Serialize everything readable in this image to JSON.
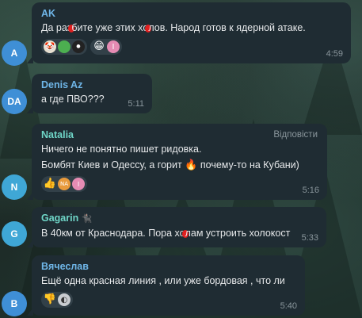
{
  "messages": [
    {
      "sender": "AK",
      "sender_color": "#6fb6e8",
      "avatar_initials": "A",
      "avatar_color": "#3f8fd6",
      "text_a": "Да раз",
      "text_b": "бите уже этих хо",
      "text_c": "лов. Народ готов к ядерной атаке.",
      "time": "4:59",
      "reactions": [
        "clown-face",
        "sticker",
        "sticker",
        "grinning-face",
        "pink-avatar"
      ]
    },
    {
      "sender": "Denis Az",
      "sender_color": "#6fb6e8",
      "avatar_initials": "DA",
      "avatar_color": "#3f8fd6",
      "text": "а где ПВО???",
      "time": "5:11"
    },
    {
      "sender": "Natalia",
      "sender_color": "#6fd6c8",
      "avatar_initials": "N",
      "avatar_color": "#3fa7d6",
      "reply_label": "Відповісти",
      "line1": "Ничего не понятно пишет ридовка.",
      "line2_a": "Бомбят Киев и Одессу, а горит",
      "line2_emoji": "🔥",
      "line2_b": "почему-то на Кубани)",
      "reaction_badges": [
        "NA",
        "I"
      ],
      "time": "5:16"
    },
    {
      "sender": "Gagarin",
      "sender_badge": "🐈‍⬛",
      "sender_color": "#6fd6c8",
      "avatar_initials": "G",
      "avatar_color": "#3fa7d6",
      "text_a": "В 40км от Краснодара. Пора хо",
      "text_b": "лам устроить холокост",
      "time": "5:33"
    },
    {
      "sender": "Вячеслав",
      "sender_color": "#6fb6e8",
      "avatar_initials": "В",
      "avatar_color": "#3f8fd6",
      "text": "Ещё одна красная линия , или уже бордовая , что ли",
      "reactions": [
        "thumbs-down",
        "profile-photo"
      ],
      "time": "5:40"
    }
  ]
}
